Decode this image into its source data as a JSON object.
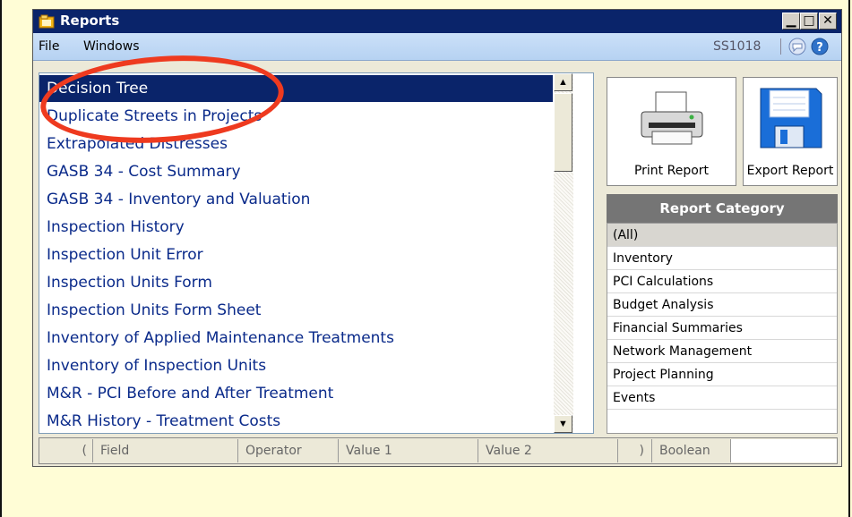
{
  "window": {
    "title": "Reports",
    "title_icon": "folder-icon",
    "buttons": [
      "minimize",
      "maximize",
      "close"
    ]
  },
  "menu": {
    "items": [
      {
        "label": "File"
      },
      {
        "label": "Windows"
      }
    ],
    "user_code": "SS1018",
    "icons": [
      "chat-icon",
      "help-icon"
    ]
  },
  "reports": {
    "selected_index": 0,
    "items": [
      "Decision Tree",
      "Duplicate Streets in Projects",
      "Extrapolated Distresses",
      "GASB 34 - Cost Summary",
      "GASB 34 - Inventory and Valuation",
      "Inspection History",
      "Inspection Unit Error",
      "Inspection Units Form",
      "Inspection Units Form Sheet",
      "Inventory of Applied Maintenance Treatments",
      "Inventory of Inspection Units",
      "M&R - PCI Before and After Treatment",
      "M&R History - Treatment Costs"
    ]
  },
  "actions": {
    "print_label": "Print Report",
    "export_label": "Export Report"
  },
  "category": {
    "header": "Report Category",
    "selected_index": 0,
    "items": [
      "(All)",
      "Inventory",
      "PCI Calculations",
      "Budget Analysis",
      "Financial Summaries",
      "Network Management",
      "Project Planning",
      "Events"
    ]
  },
  "filter": {
    "columns": [
      "(",
      "Field",
      "Operator",
      "Value 1",
      "Value 2",
      ")",
      "Boolean"
    ]
  },
  "colors": {
    "titlebar": "#0a246a",
    "list_text": "#0a2a8a",
    "annotation": "#ee3a1f",
    "page_background": "#fffdd6"
  }
}
